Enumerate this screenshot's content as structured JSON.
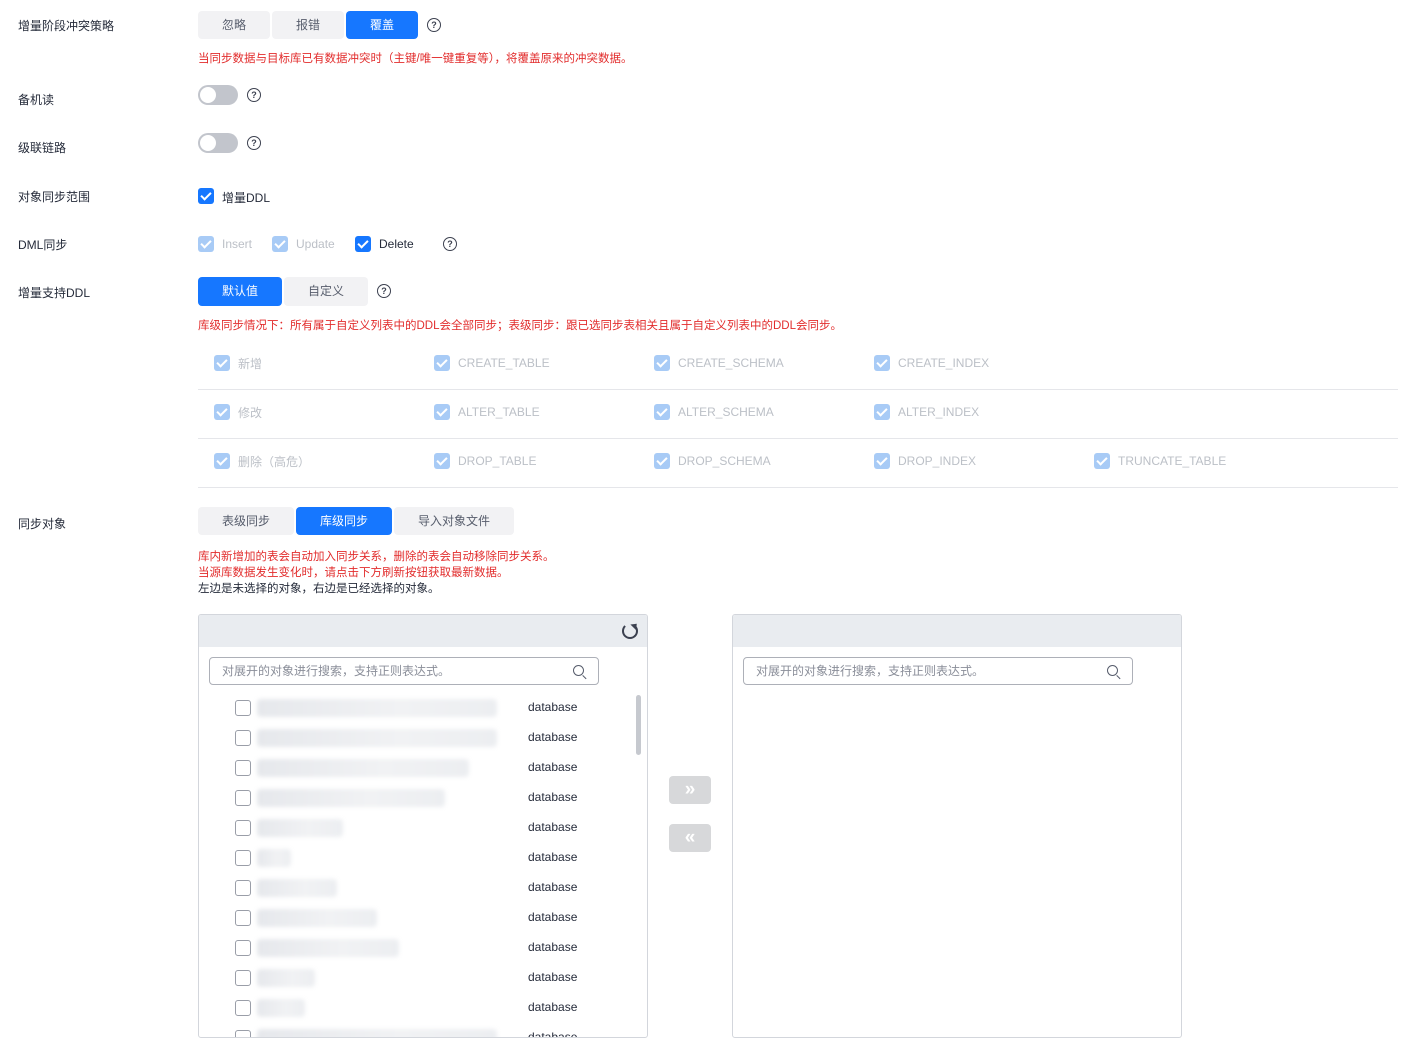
{
  "conflict_strategy": {
    "label": "增量阶段冲突策略",
    "options": [
      "忽略",
      "报错",
      "覆盖"
    ],
    "hint": "当同步数据与目标库已有数据冲突时（主键/唯一键重复等），将覆盖原来的冲突数据。"
  },
  "standby_read": {
    "label": "备机读"
  },
  "cascade_link": {
    "label": "级联链路"
  },
  "object_scope": {
    "label": "对象同步范围",
    "option": "增量DDL"
  },
  "dml_sync": {
    "label": "DML同步",
    "insert": "Insert",
    "update": "Update",
    "delete": "Delete"
  },
  "ddl_support": {
    "label": "增量支持DDL",
    "options": [
      "默认值",
      "自定义"
    ],
    "hint": "库级同步情况下：所有属于自定义列表中的DDL会全部同步；表级同步：跟已选同步表相关且属于自定义列表中的DDL会同步。",
    "rows": [
      [
        "新增",
        "CREATE_TABLE",
        "CREATE_SCHEMA",
        "CREATE_INDEX"
      ],
      [
        "修改",
        "ALTER_TABLE",
        "ALTER_SCHEMA",
        "ALTER_INDEX"
      ],
      [
        "删除（高危）",
        "DROP_TABLE",
        "DROP_SCHEMA",
        "DROP_INDEX",
        "TRUNCATE_TABLE"
      ]
    ]
  },
  "sync_objects": {
    "label": "同步对象",
    "tabs": [
      "表级同步",
      "库级同步",
      "导入对象文件"
    ],
    "hint1": "库内新增加的表会自动加入同步关系，删除的表会自动移除同步关系。",
    "hint2": "当源库数据发生变化时，请点击下方刷新按钮获取最新数据。",
    "hint3": "左边是未选择的对象，右边是已经选择的对象。",
    "search_placeholder": "对展开的对象进行搜索，支持正则表达式。",
    "left_items": [
      "database",
      "database",
      "database",
      "database",
      "database",
      "database",
      "database",
      "database",
      "database",
      "database",
      "database",
      "database"
    ],
    "move_right": "»",
    "move_left": "«"
  },
  "colors": {
    "primary": "#1677ff",
    "warning": "#e22c2c",
    "disabled_check": "#a8cbf6"
  }
}
